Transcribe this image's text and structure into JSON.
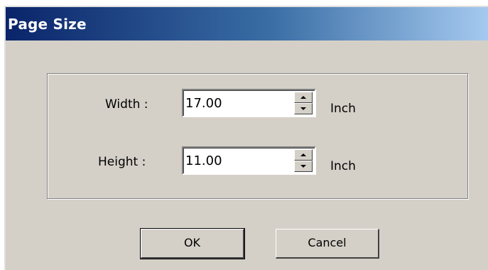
{
  "window": {
    "title": "Page Size"
  },
  "fields": {
    "width": {
      "label": "Width :",
      "value": "17.00",
      "unit": "Inch"
    },
    "height": {
      "label": "Height :",
      "value": "11.00",
      "unit": "Inch"
    }
  },
  "buttons": {
    "ok_label": "OK",
    "cancel_label": "Cancel"
  },
  "colors": {
    "titlebar_start": "#0a246a",
    "titlebar_end": "#a6caf0",
    "dialog_bg": "#d4d0c8"
  },
  "icons": {
    "spin_up": "spin-up-arrow-icon",
    "spin_down": "spin-down-arrow-icon"
  }
}
